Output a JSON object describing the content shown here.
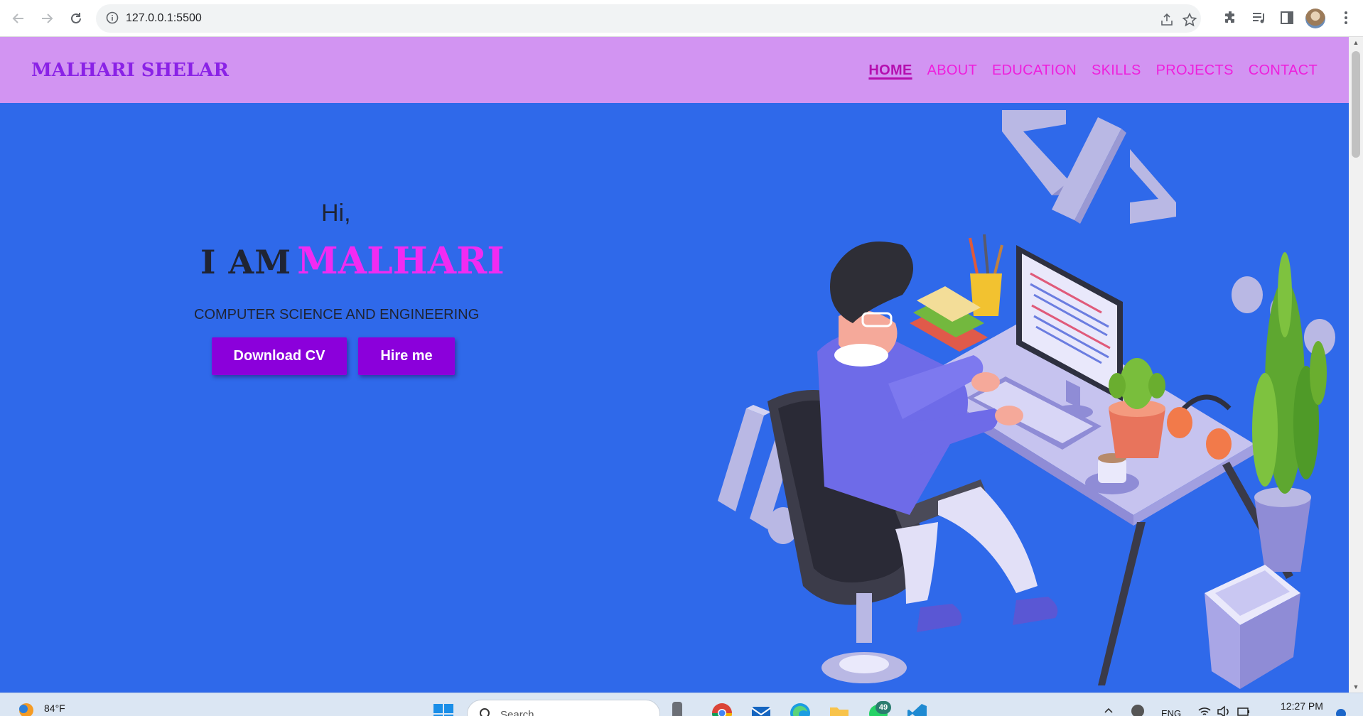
{
  "browser": {
    "url": "127.0.0.1:5500"
  },
  "site": {
    "brand": "MALHARI SHELAR",
    "nav": [
      {
        "label": "HOME",
        "active": true
      },
      {
        "label": "ABOUT",
        "active": false
      },
      {
        "label": "EDUCATION",
        "active": false
      },
      {
        "label": "SKILLS",
        "active": false
      },
      {
        "label": "PROJECTS",
        "active": false
      },
      {
        "label": "CONTACT",
        "active": false
      }
    ]
  },
  "hero": {
    "greeting": "Hi,",
    "intro": "I AM",
    "name": "MALHARI",
    "subtitle": "COMPUTER SCIENCE AND ENGINEERING",
    "download_label": "Download CV",
    "hire_label": "Hire me",
    "illustration": "developer-at-desk-illustration"
  },
  "taskbar": {
    "temperature": "84°F",
    "search_placeholder": "Search",
    "notification_count": "49",
    "language": "ENG",
    "time": "12:27 PM"
  },
  "colors": {
    "hero_bg": "#2f69ea",
    "header_bg": "#d294f2",
    "brand": "#8a22e6",
    "nav_link": "#ee1fdc",
    "button_bg": "#8b00db",
    "name_accent": "#f12bf2"
  },
  "icons": [
    "back-arrow-icon",
    "forward-arrow-icon",
    "reload-icon",
    "info-icon",
    "share-icon",
    "star-icon",
    "extensions-icon",
    "media-icon",
    "side-panel-icon",
    "profile-avatar",
    "more-menu-icon",
    "weather-icon",
    "windows-start-icon",
    "search-icon",
    "chrome-icon",
    "mail-icon",
    "edge-icon",
    "folder-icon",
    "whatsapp-icon",
    "vscode-icon",
    "wifi-icon",
    "volume-icon",
    "battery-icon"
  ]
}
